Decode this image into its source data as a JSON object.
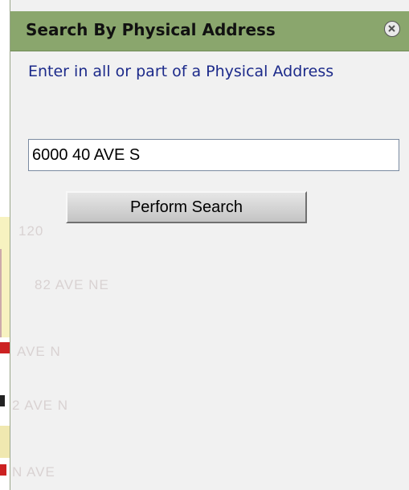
{
  "panel": {
    "title": "Search By Physical Address",
    "close_icon": "close-circle-icon",
    "instruction": "Enter in all or part of a Physical Address"
  },
  "search": {
    "address_value": "6000 40 AVE S",
    "button_label": "Perform Search"
  },
  "map_labels": {
    "label_1": "120",
    "label_2": "82 AVE NE",
    "label_3": "AVE N",
    "label_4": "2 AVE N",
    "label_5": "N AVE"
  },
  "colors": {
    "title_bar": "#8aa66d",
    "panel_bg": "#f1f1f1",
    "instruction_text": "#1c2a8a"
  }
}
